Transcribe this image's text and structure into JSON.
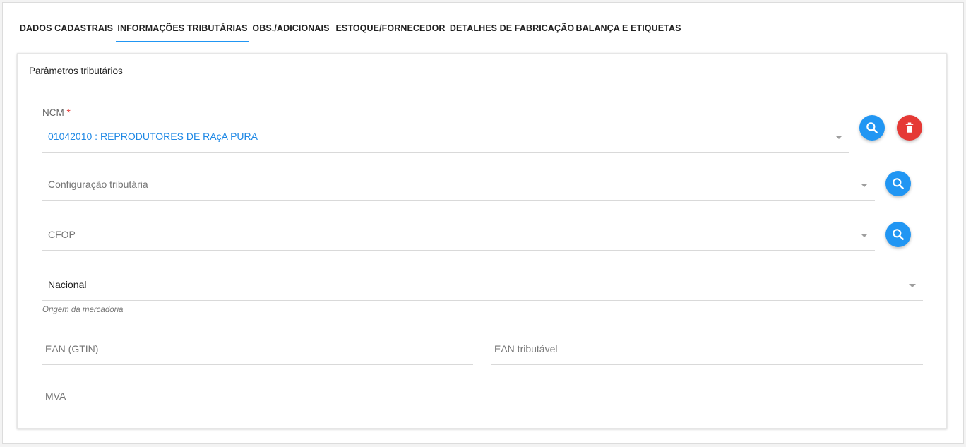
{
  "tabs": [
    {
      "label": "DADOS CADASTRAIS",
      "active": false
    },
    {
      "label": "INFORMAÇÕES TRIBUTÁRIAS",
      "active": true
    },
    {
      "label": "OBS./ADICIONAIS",
      "active": false
    },
    {
      "label": "ESTOQUE/FORNECEDOR",
      "active": false
    },
    {
      "label": "DETALHES DE FABRICAÇÃO",
      "active": false
    },
    {
      "label": "BALANÇA E ETIQUETAS",
      "active": false
    }
  ],
  "card": {
    "title": "Parâmetros tributários"
  },
  "ncm": {
    "label": "NCM",
    "required_mark": "*",
    "value": "01042010 : REPRODUTORES DE RAçA PURA"
  },
  "config_tributaria": {
    "placeholder": "Configuração tributária"
  },
  "cfop": {
    "placeholder": "CFOP"
  },
  "origem": {
    "value": "Nacional",
    "hint": "Origem da mercadoria"
  },
  "ean_gtin": {
    "placeholder": "EAN (GTIN)"
  },
  "ean_tributavel": {
    "placeholder": "EAN tributável"
  },
  "mva": {
    "placeholder": "MVA"
  },
  "colors": {
    "accent": "#2196f3",
    "danger": "#e53935",
    "value_blue": "#1e88e5"
  },
  "icons": {
    "search": "search-icon",
    "delete": "trash-icon",
    "dropdown": "caret-down-icon"
  }
}
